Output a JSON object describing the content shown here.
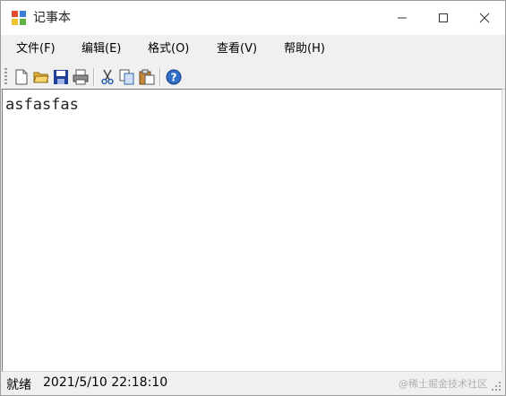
{
  "window": {
    "title": "记事本"
  },
  "menu": [
    {
      "label": "文件(F)"
    },
    {
      "label": "编辑(E)"
    },
    {
      "label": "格式(O)"
    },
    {
      "label": "查看(V)"
    },
    {
      "label": "帮助(H)"
    }
  ],
  "toolbar": {
    "buttons": [
      {
        "icon": "new-file-icon"
      },
      {
        "icon": "open-folder-icon"
      },
      {
        "icon": "save-icon"
      },
      {
        "icon": "print-icon"
      },
      {
        "icon": "cut-icon"
      },
      {
        "icon": "copy-icon"
      },
      {
        "icon": "paste-icon"
      },
      {
        "icon": "help-icon"
      }
    ]
  },
  "editor": {
    "content": "asfasfas"
  },
  "status": {
    "label": "就绪",
    "datetime": "2021/5/10 22:18:10"
  },
  "watermark": "@稀土掘金技术社区",
  "colors": {
    "save": "#1f3f9a",
    "help": "#2f6fc8",
    "folder": "#e8b33a"
  }
}
